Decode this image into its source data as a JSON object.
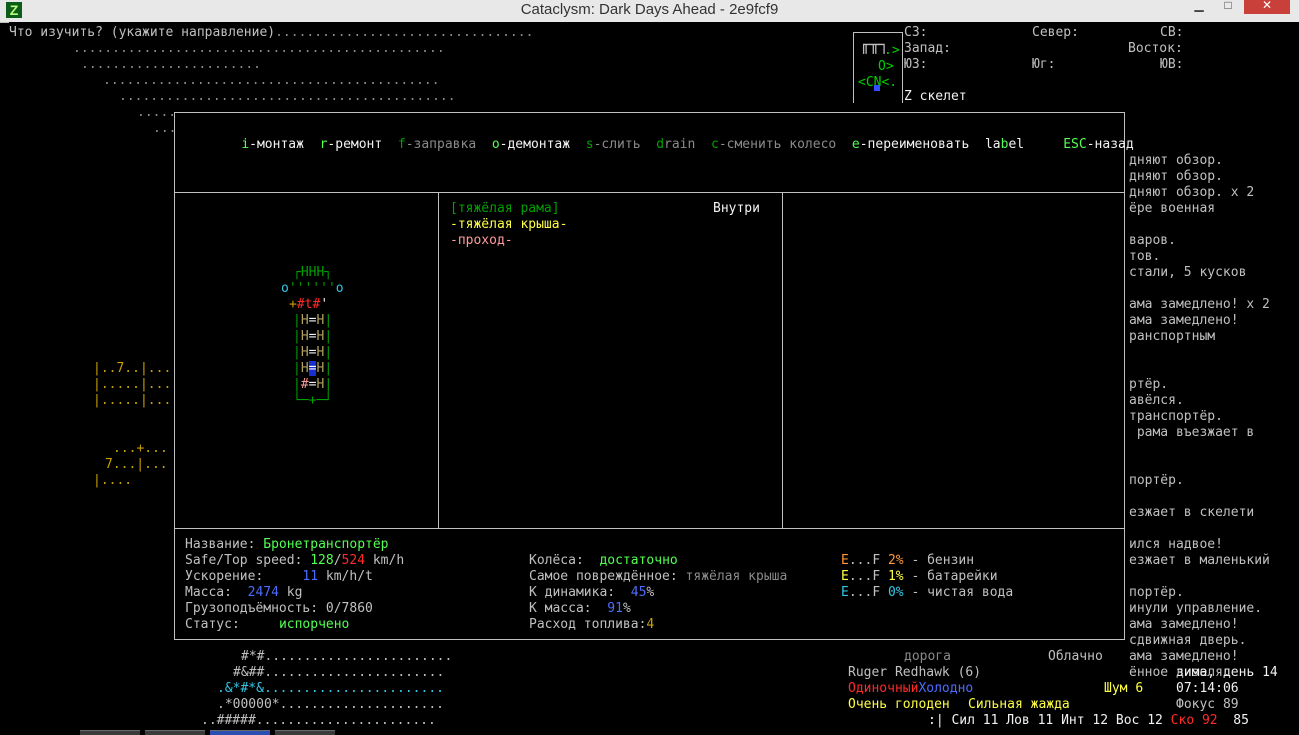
{
  "window": {
    "title": "Cataclysm: Dark Days Ahead - 2e9fcf9",
    "icon": "Z"
  },
  "prompt": "Что изучить? (укажите направление)",
  "map_top": [
    ".......................",
    ".......................",
    "...........................................",
    "...........................................",
    ".........................",
    "........",
    "..."
  ],
  "compass": {
    "nw": "СЗ:",
    "n": "Север:",
    "ne": "СВ:",
    "w": "Запад:",
    "e": "Восток:",
    "sw": "ЮЗ:",
    "s": "Юг:",
    "se": "ЮВ:",
    "target_glyph": "Z",
    "target_name": "скелет"
  },
  "minimap": {
    "row1": ".>",
    "row2": "O>",
    "row3": "<CN<."
  },
  "menu": {
    "install": {
      "key": "i",
      "label": "-монтаж"
    },
    "repair": {
      "key": "r",
      "label": "-ремонт"
    },
    "refill": {
      "key": "f",
      "label": "-заправка"
    },
    "remove": {
      "key": "o",
      "label": "-демонтаж"
    },
    "siphon": {
      "key": "s",
      "label": "-слить"
    },
    "drain": {
      "key": "d",
      "label": "rain"
    },
    "change_wheel": {
      "key": "c",
      "label": "-сменить колесо"
    },
    "rename": {
      "key": "e",
      "label": "-переименовать"
    },
    "label": {
      "key": "la",
      "key2": "b",
      "label": "el"
    },
    "back": {
      "key": "ESC",
      "label": "-назад"
    }
  },
  "parts": {
    "header": "Внутри",
    "items": [
      {
        "name": "[тяжёлая рама]",
        "state": "selected"
      },
      {
        "name": "-тяжёлая крыша-",
        "state": "normal"
      },
      {
        "name": "-проход-",
        "state": "warn"
      }
    ]
  },
  "vehicle_map": {
    "rows": [
      "┌HHH┐",
      "o''''''o",
      "+#t#'",
      "H=H",
      "H=H",
      "H=H",
      "H=H",
      "#=H",
      "+"
    ]
  },
  "stats": {
    "name_label": "Название:",
    "name": "Бронетранспортёр",
    "speed_label": "Safe/Top speed:",
    "speed_safe": "128",
    "speed_sep": "/",
    "speed_top": "524",
    "speed_unit": "km/h",
    "accel_label": "Ускорение:",
    "accel": "11",
    "accel_unit": "km/h/t",
    "mass_label": "Масса:",
    "mass": "2474",
    "mass_unit": "kg",
    "capacity_label": "Грузоподъёмность:",
    "capacity": "0/7860",
    "status_label": "Статус:",
    "status": "испорчено",
    "wheels_label": "Колёса:",
    "wheels": "достаточно",
    "damaged_label": "Самое повреждённое:",
    "damaged": "тяжёлая крыша",
    "dyn_label": "К динамика:",
    "dyn": "45",
    "dyn_unit": "%",
    "kmass_label": "К масса:",
    "kmass": "91",
    "kmass_unit": "%",
    "fuel_use_label": "Расход топлива:",
    "fuel_use": "4"
  },
  "fuel": [
    {
      "e": "E",
      "dots": "...",
      "f": "F",
      "pct": "2%",
      "name": "- бензин",
      "color": "#ff9a3a"
    },
    {
      "e": "E",
      "dots": "...",
      "f": "F",
      "pct": "1%",
      "name": "- батарейки",
      "color": "#ffff44"
    },
    {
      "e": "E",
      "dots": "...",
      "f": "F",
      "pct": "0%",
      "name": "- чистая вода",
      "color": "#33c6e6"
    }
  ],
  "log": [
    "дняют обзор.",
    "дняют обзор.",
    "дняют обзор. x 2",
    "ёре военная",
    "",
    "варов.",
    "тов.",
    "стали, 5 кусков",
    "",
    "ама замедлено! x 2",
    "ама замедлено!",
    "ранспортным",
    "",
    "",
    "ртёр.",
    "авёлся.",
    "транспортёр.",
    " рама въезжает в",
    "",
    "",
    "портёр.",
    "",
    "езжает в скелети",
    "",
    "ился надвое!",
    "езжает в маленький",
    "",
    "портёр.",
    "инули управление.",
    "ама замедлено!",
    "сдвижная дверь.",
    "ама замедлено!",
    "ённое дизеля."
  ],
  "map_left": [
    "|..7..|...",
    "|.....|...",
    "|.....|...",
    "",
    "",
    "...+...",
    "7...|...",
    "|...."
  ],
  "map_bottom": [
    "#*#........................",
    "#&##.......................",
    ".&*#*&.......................",
    ".*00000*.....................",
    "..#####......................."
  ],
  "sidebar": {
    "terrain": "дорога",
    "weather": "Облачно",
    "character": "Ruger Redhawk (6)",
    "date": "зима, день 14",
    "status_single": "Одиночный",
    "status_cold": "Холодно",
    "noise_label": "Шум",
    "noise": "6",
    "time": "07:14:06",
    "hunger": "Очень голоден",
    "thirst": "Сильная жажда",
    "focus_label": "Фокус",
    "focus": "89",
    "stat_prefix": ":|",
    "str_label": "Сил",
    "str": "11",
    "dex_label": "Лов",
    "dex": "11",
    "int_label": "Инт",
    "int": "12",
    "per_label": "Вос",
    "per": "12",
    "spd_label": "Ско",
    "spd": "92",
    "move": "85"
  }
}
